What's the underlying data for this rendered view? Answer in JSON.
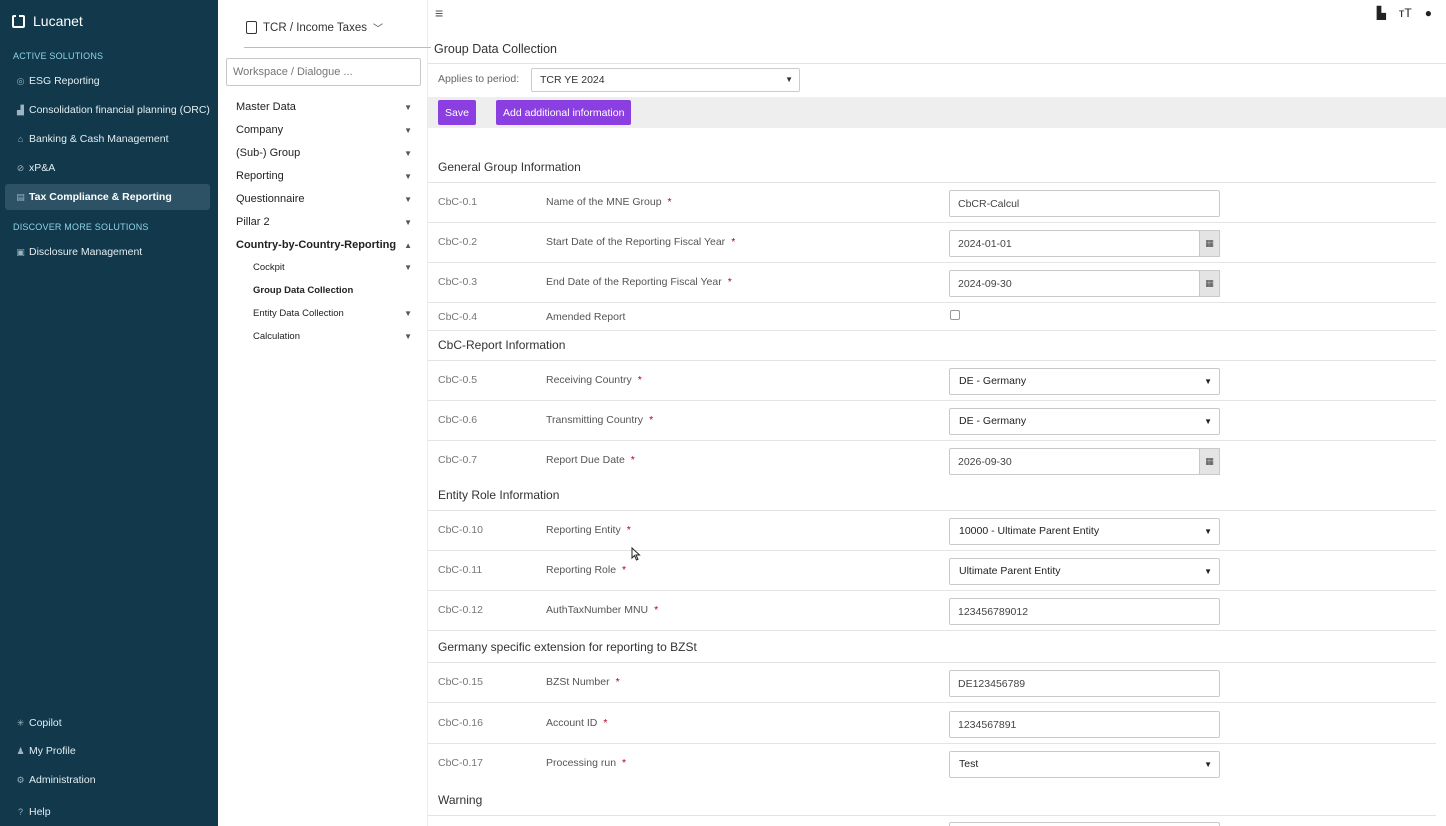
{
  "brand": {
    "name": "Lucanet"
  },
  "nav": {
    "active_solutions_label": "ACTIVE SOLUTIONS",
    "discover_label": "DISCOVER MORE SOLUTIONS",
    "items": [
      {
        "label": "ESG Reporting",
        "icon": "leaf-icon"
      },
      {
        "label": "Consolidation financial planning (ORC)",
        "icon": "chart-icon"
      },
      {
        "label": "Banking & Cash Management",
        "icon": "bank-icon"
      },
      {
        "label": "xP&A",
        "icon": "compass-icon"
      },
      {
        "label": "Tax Compliance & Reporting",
        "icon": "clipboard-icon"
      }
    ],
    "discover_items": [
      {
        "label": "Disclosure Management",
        "icon": "document-icon"
      }
    ],
    "bottom": [
      {
        "label": "Copilot",
        "icon": "sparkle-icon"
      },
      {
        "label": "My Profile",
        "icon": "user-icon"
      },
      {
        "label": "Administration",
        "icon": "gear-icon"
      },
      {
        "label": "Help",
        "icon": "help-icon"
      }
    ]
  },
  "workspace": {
    "title": "TCR / Income Taxes",
    "search_placeholder": "Workspace / Dialogue ...",
    "menu": [
      {
        "label": "Master Data"
      },
      {
        "label": "Company"
      },
      {
        "label": "(Sub-) Group"
      },
      {
        "label": "Reporting"
      },
      {
        "label": "Questionnaire"
      },
      {
        "label": "Pillar 2"
      },
      {
        "label": "Country-by-Country-Reporting"
      }
    ],
    "submenu": [
      {
        "label": "Cockpit"
      },
      {
        "label": "Group Data Collection"
      },
      {
        "label": "Entity Data Collection"
      },
      {
        "label": "Calculation"
      }
    ]
  },
  "page": {
    "title": "Group Data Collection",
    "period_label": "Applies to period:",
    "period_value": "TCR YE 2024",
    "save_label": "Save",
    "add_info_label": "Add additional information",
    "required_mark": "*"
  },
  "sections": [
    {
      "title": "General Group Information"
    },
    {
      "title": "CbC-Report Information"
    },
    {
      "title": "Entity Role Information"
    },
    {
      "title": "Germany specific extension for reporting to BZSt"
    },
    {
      "title": "Warning"
    }
  ],
  "rows": [
    {
      "code": "CbC-0.1",
      "label": "Name of the MNE Group",
      "value": "CbCR-Calcul"
    },
    {
      "code": "CbC-0.2",
      "label": "Start Date of the Reporting Fiscal Year",
      "value": "2024-01-01"
    },
    {
      "code": "CbC-0.3",
      "label": "End Date of the Reporting Fiscal Year",
      "value": "2024-09-30"
    },
    {
      "code": "CbC-0.4",
      "label": "Amended Report",
      "checked": false
    },
    {
      "code": "CbC-0.5",
      "label": "Receiving Country",
      "value": "DE - Germany"
    },
    {
      "code": "CbC-0.6",
      "label": "Transmitting Country",
      "value": "DE - Germany"
    },
    {
      "code": "CbC-0.7",
      "label": "Report Due Date",
      "value": "2026-09-30"
    },
    {
      "code": "CbC-0.10",
      "label": "Reporting Entity",
      "value": "10000 - Ultimate Parent Entity"
    },
    {
      "code": "CbC-0.11",
      "label": "Reporting Role",
      "value": "Ultimate Parent Entity"
    },
    {
      "code": "CbC-0.12",
      "label": "AuthTaxNumber MNU",
      "value": "123456789012"
    },
    {
      "code": "CbC-0.15",
      "label": "BZSt Number",
      "value": "DE123456789"
    },
    {
      "code": "CbC-0.16",
      "label": "Account ID",
      "value": "1234567891"
    },
    {
      "code": "CbC-0.17",
      "label": "Processing run",
      "value": "Test"
    }
  ]
}
